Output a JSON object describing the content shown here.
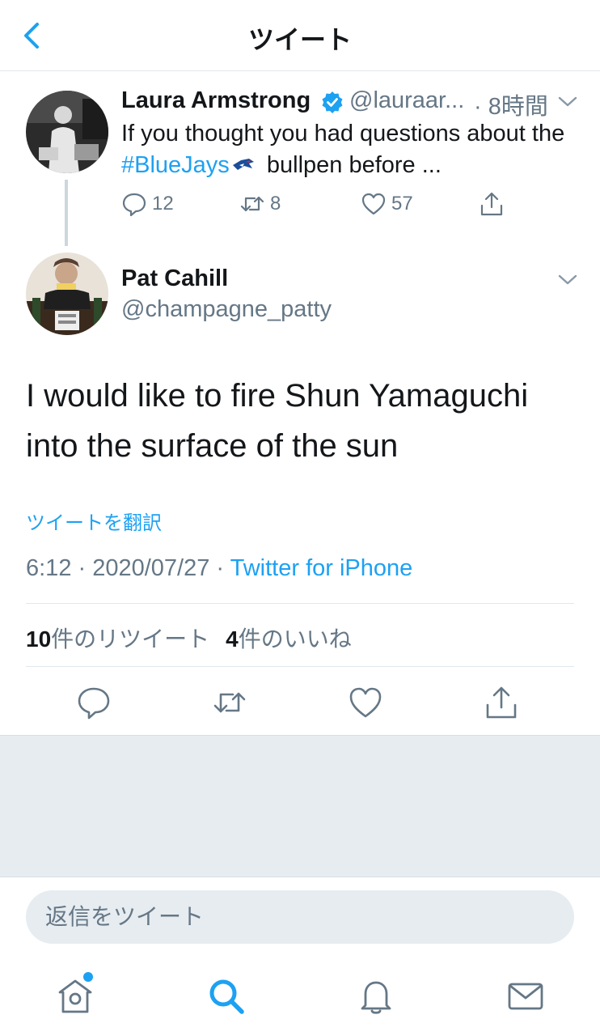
{
  "header": {
    "title": "ツイート",
    "back_icon": "chevron-left-icon"
  },
  "quoted_tweet": {
    "name": "Laura Armstrong",
    "handle": "@lauraar...",
    "time": "· 8時間",
    "text_before": "If you thought you had questions about the ",
    "hashtag": "#BlueJays",
    "text_after": " bullpen before ...",
    "replies": "12",
    "retweets": "8",
    "likes": "57"
  },
  "main_tweet": {
    "name": "Pat Cahill",
    "handle": "@champagne_patty",
    "text": "I would like to fire Shun Yamaguchi into the surface of the sun",
    "translate": "ツイートを翻訳",
    "timestamp": "6:12 · 2020/07/27 · ",
    "source": "Twitter for iPhone",
    "retweet_count": "10",
    "retweet_label": "件のリツイート",
    "like_count": "4",
    "like_label": "件のいいね"
  },
  "reply": {
    "placeholder": "返信をツイート"
  },
  "tabbar": {
    "items": [
      "home-icon",
      "search-icon",
      "notifications-icon",
      "messages-icon"
    ],
    "active": "search-icon"
  },
  "colors": {
    "accent": "#1da1f2",
    "secondary_text": "#657786",
    "divider": "#e1e8ed",
    "background_grey": "#e6ecf0"
  }
}
